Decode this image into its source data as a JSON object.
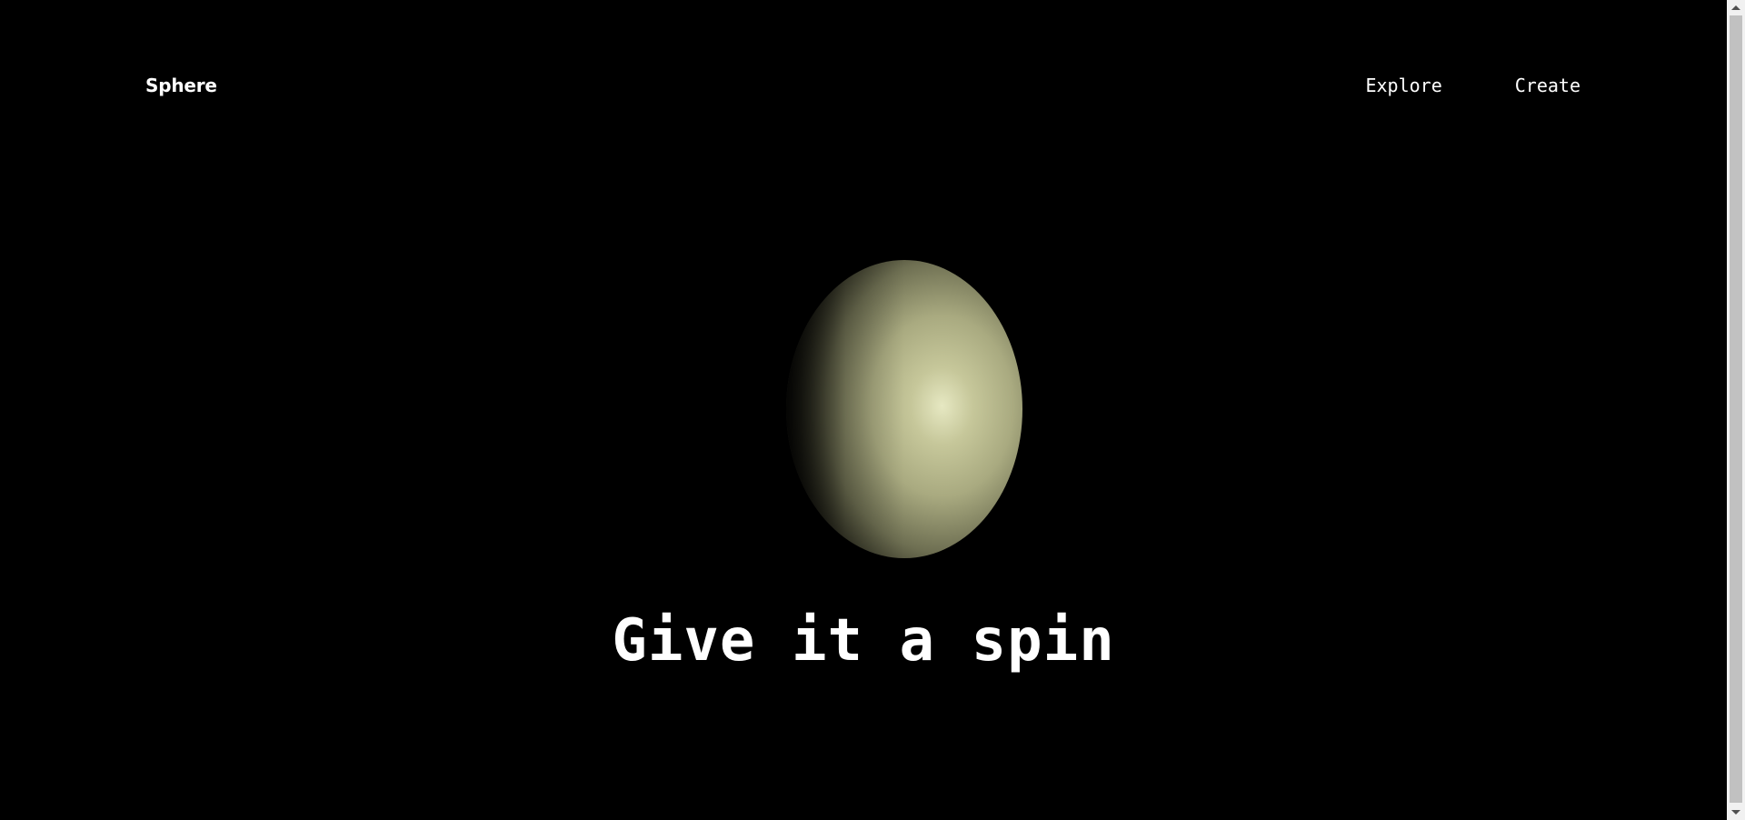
{
  "header": {
    "logo": "Sphere",
    "nav": [
      {
        "label": "Explore"
      },
      {
        "label": "Create"
      }
    ]
  },
  "hero": {
    "headline": "Give it a spin",
    "sphere_color": "#d8d8a8"
  },
  "colors": {
    "background": "#000000",
    "text": "#ffffff"
  },
  "icons": {
    "scroll_up": "chevron-up-icon",
    "scroll_down": "chevron-down-icon"
  }
}
